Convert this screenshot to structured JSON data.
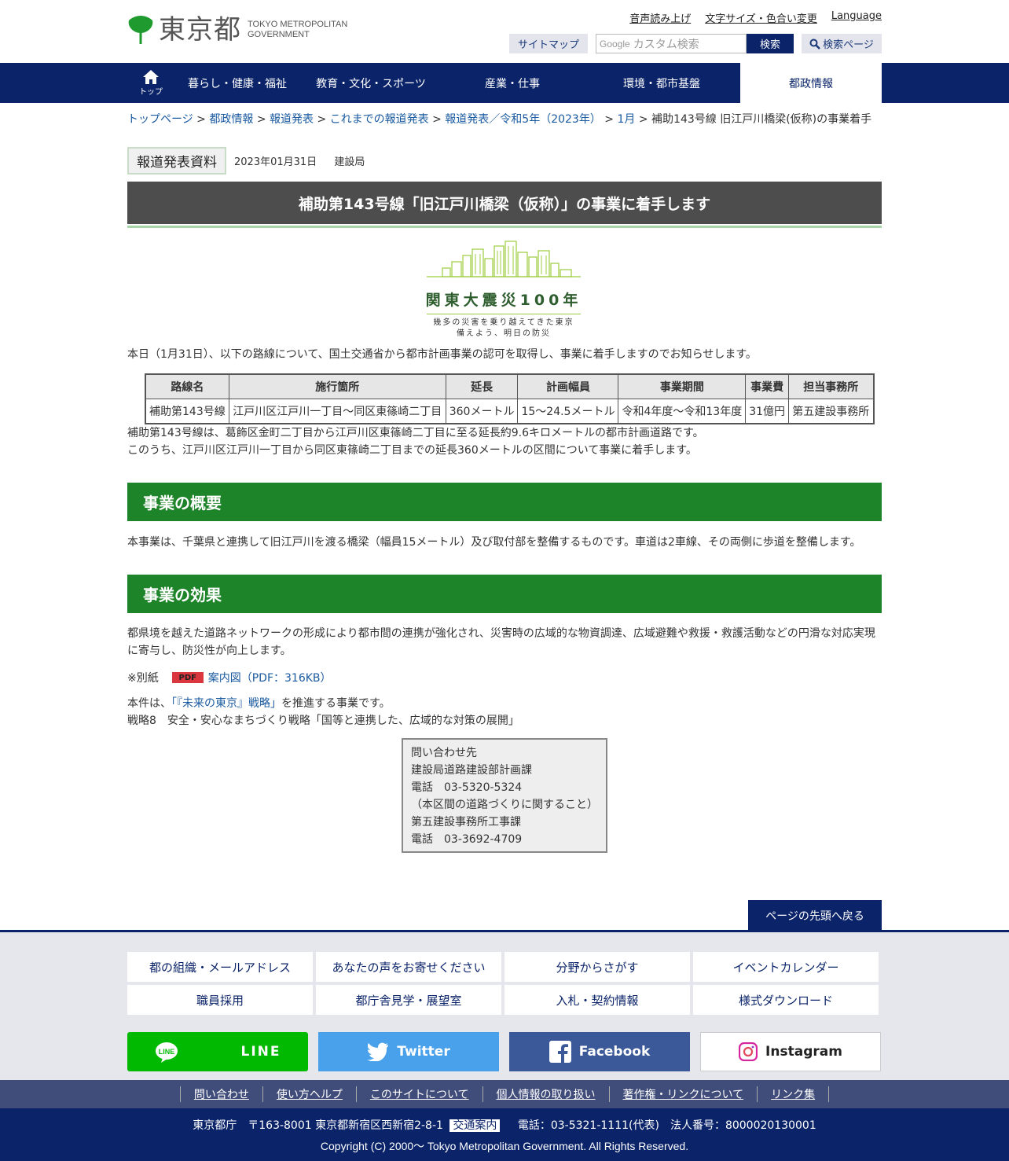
{
  "header": {
    "logo_name": "東京都",
    "logo_en_1": "TOKYO METROPOLITAN",
    "logo_en_2": "GOVERNMENT",
    "util_links": [
      "音声読み上げ",
      "文字サイズ・色合い変更",
      "Language"
    ],
    "sitemap": "サイトマップ",
    "search_placeholder": "カスタム検索",
    "search_brand": "Google",
    "search_button": "検索",
    "search_page": "検索ページ"
  },
  "gnav": {
    "home_label": "トップ",
    "items": [
      "暮らし・健康・福祉",
      "教育・文化・スポーツ",
      "産業・仕事",
      "環境・都市基盤",
      "都政情報"
    ],
    "active_index": 4
  },
  "breadcrumb": {
    "links": [
      "トップページ",
      "都政情報",
      "報道発表",
      "これまでの報道発表",
      "報道発表／令和5年（2023年）",
      "1月"
    ],
    "current": "補助143号線 旧江戸川橋梁(仮称)の事業着手"
  },
  "press": {
    "badge": "報道発表資料",
    "date": "2023年01月31日",
    "bureau": "建設局"
  },
  "title": "補助第143号線「旧江戸川橋梁（仮称）」の事業に着手します",
  "banner": {
    "title": "関東大震災100年",
    "line1": "幾多の災害を乗り越えてきた東京",
    "line2": "備えよう、明日の防災"
  },
  "intro": "本日（1月31日）、以下の路線について、国土交通省から都市計画事業の認可を取得し、事業に着手しますのでお知らせします。",
  "table": {
    "headers": [
      "路線名",
      "施行箇所",
      "延長",
      "計画幅員",
      "事業期間",
      "事業費",
      "担当事務所"
    ],
    "row": [
      "補助第143号線",
      "江戸川区江戸川一丁目～同区東篠崎二丁目",
      "360メートル",
      "15～24.5メートル",
      "令和4年度～令和13年度",
      "31億円",
      "第五建設事務所"
    ]
  },
  "after_table_1": "補助第143号線は、葛飾区金町二丁目から江戸川区東篠崎二丁目に至る延長約9.6キロメートルの都市計画道路です。",
  "after_table_2": "このうち、江戸川区江戸川一丁目から同区東篠崎二丁目までの延長360メートルの区間について事業に着手します。",
  "section1": {
    "heading": "事業の概要",
    "body": "本事業は、千葉県と連携して旧江戸川を渡る橋梁（幅員15メートル）及び取付部を整備するものです。車道は2車線、その両側に歩道を整備します。"
  },
  "section2": {
    "heading": "事業の効果",
    "body1": "都県境を越えた道路ネットワークの形成により都市間の連携が強化され、災害時の広域的な物資調達、広域避難や救援・救護活動などの円滑な対応実現",
    "body2": "に寄与し、防災性が向上します。"
  },
  "attachment": {
    "prefix": "※別紙",
    "pdf_label": "PDF",
    "link": "案内図（PDF：316KB）"
  },
  "strategy": {
    "pre": "本件は、",
    "link": "「『未来の東京』戦略」",
    "post": "を推進する事業です。",
    "line2": "戦略8　安全・安心なまちづくり戦略「国等と連携した、広域的な対策の展開」"
  },
  "contact": {
    "lines": [
      "問い合わせ先",
      "建設局道路建設部計画課",
      "電話　03-5320-5324",
      "（本区間の道路づくりに関すること）",
      "第五建設事務所工事課",
      "電話　03-3692-4709"
    ]
  },
  "back_to_top": "ページの先頭へ戻る",
  "footer": {
    "grid": [
      "都の組織・メールアドレス",
      "あなたの声をお寄せください",
      "分野からさがす",
      "イベントカレンダー",
      "職員採用",
      "都庁舎見学・展望室",
      "入札・契約情報",
      "様式ダウンロード"
    ],
    "social": [
      "LINE",
      "Twitter",
      "Facebook",
      "Instagram"
    ],
    "links": [
      "問い合わせ",
      "使い方ヘルプ",
      "このサイトについて",
      "個人情報の取り扱い",
      "著作権・リンクについて",
      "リンク集"
    ],
    "address": "東京都庁　〒163-8001 東京都新宿区西新宿2-8-1",
    "access": "交通案内",
    "phone": "電話：03-5321-1111(代表)　法人番号：8000020130001",
    "copyright": "Copyright (C) 2000～ Tokyo Metropolitan Government. All Rights Reserved."
  },
  "colors": {
    "navy": "#0a2369",
    "green": "#1e8429",
    "title_gray": "#4d4d4d",
    "link_blue": "#1a5aa0"
  }
}
